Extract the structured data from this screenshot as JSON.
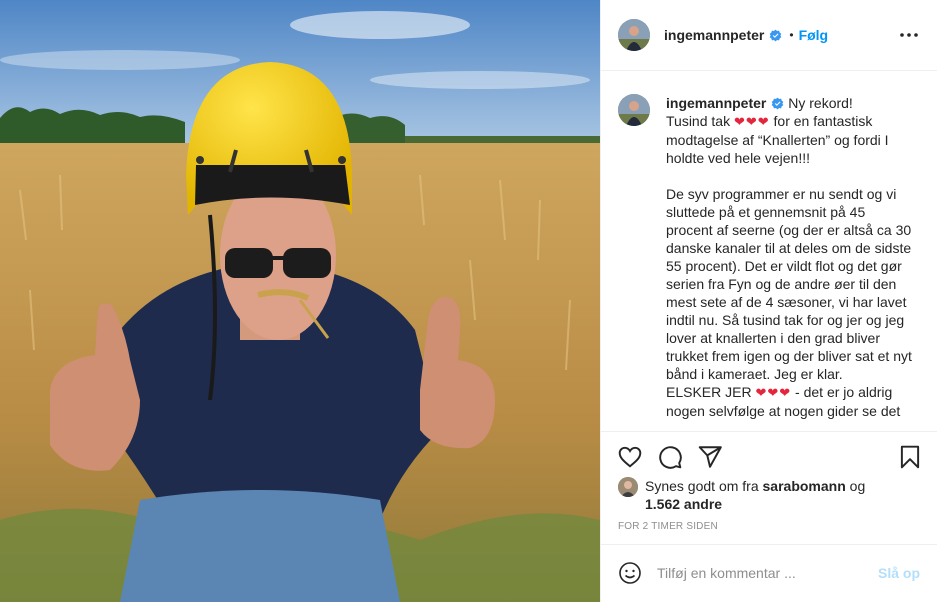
{
  "post": {
    "username": "ingemannpeter",
    "verified": true,
    "follow_separator": "•",
    "follow_label": "Følg",
    "more_icon": "more-horizontal-icon"
  },
  "caption": {
    "username": "ingemannpeter",
    "line1": "Ny rekord!",
    "thanks_prefix": "Tusind tak ",
    "thanks_hearts": "❤❤❤",
    "thanks_rest": " for en fantastisk modtagelse af “Knallerten” og fordi I holdte ved hele vejen!!!",
    "paragraph2": "De syv programmer er nu sendt og vi sluttede på et gennemsnit på 45 procent af seerne (og der er altså ca 30 danske kanaler til at deles om de sidste 55 procent). Det er vildt flot og det gør serien fra Fyn og de andre øer til den mest sete af de 4 sæsoner, vi har lavet indtil nu. Så tusind tak for og jer og jeg lover at knallerten i den grad bliver trukket frem igen og der bliver sat et nyt bånd i kameraet. Jeg er klar.",
    "elsker_prefix": "ELSKER JER ",
    "elsker_hearts": "❤❤❤",
    "elsker_rest": " - det er jo aldrig nogen selvfølge at nogen gider se det"
  },
  "actions": {
    "like_icon": "heart-icon",
    "comment_icon": "comment-icon",
    "share_icon": "send-icon",
    "save_icon": "bookmark-icon"
  },
  "likes": {
    "prefix": "Synes godt om fra ",
    "user": "sarabomann",
    "joiner": " og ",
    "count": "1.562 andre"
  },
  "timestamp": "FOR 2 TIMER SIDEN",
  "comment": {
    "placeholder": "Tilføj en kommentar ...",
    "post_label": "Slå op",
    "emoji_icon": "smiley-icon"
  },
  "colors": {
    "accent": "#0095f6",
    "heart": "#e3263b",
    "post_disabled": "#b2dffc",
    "muted": "#8e8e8e"
  }
}
